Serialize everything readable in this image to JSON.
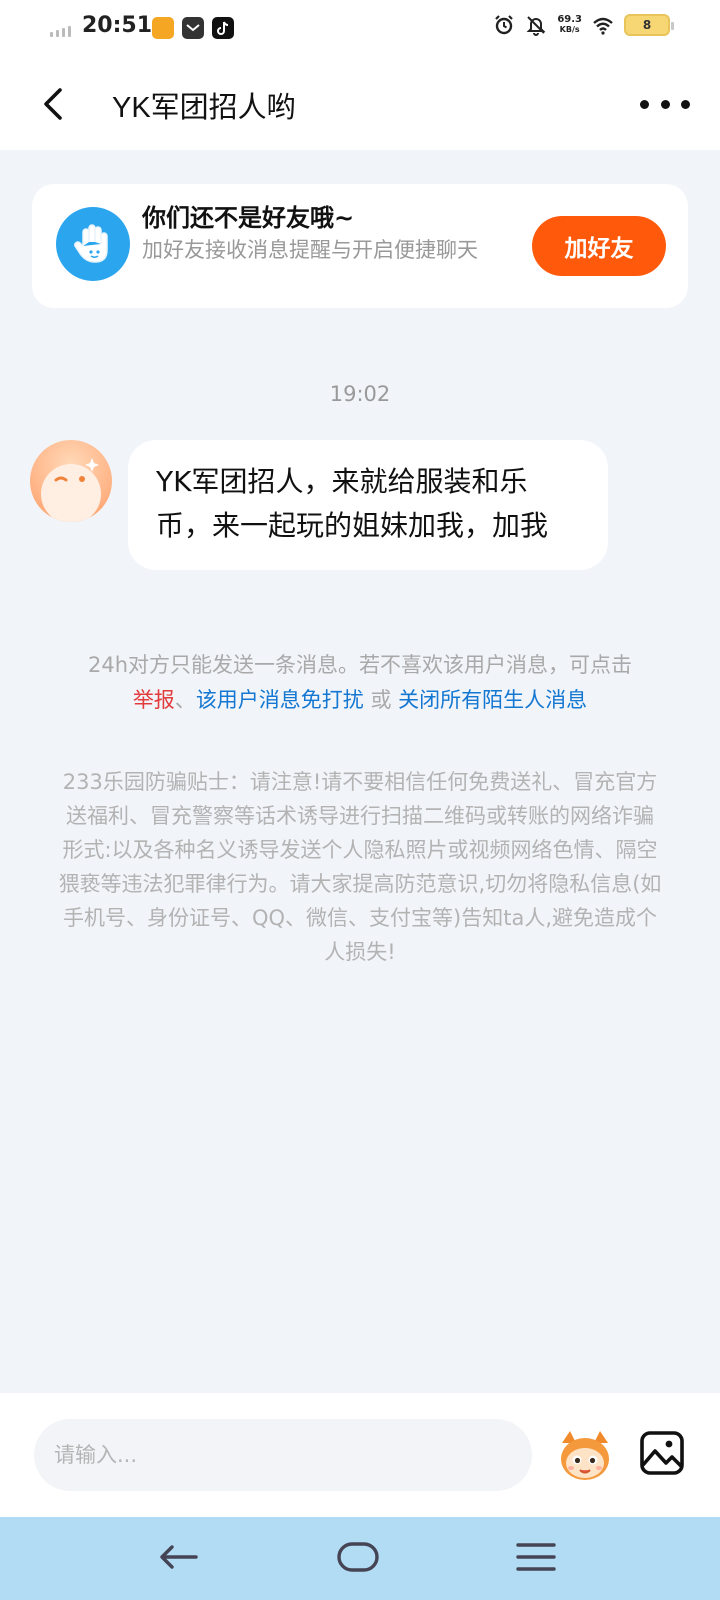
{
  "status_bar": {
    "time": "20:51",
    "net_speed_value": "69.3",
    "net_speed_unit": "KB/s",
    "battery_level": "8",
    "app_icons": [
      "video-app-icon",
      "mail-app-icon",
      "tiktok-icon"
    ],
    "status_icons": [
      "alarm-icon",
      "mute-icon",
      "wifi-icon",
      "battery-icon"
    ]
  },
  "header": {
    "title": "YK军团招人哟",
    "icons": [
      "back-arrow-icon",
      "more-dots-icon"
    ]
  },
  "friend_card": {
    "title": "你们还不是好友哦~",
    "subtitle": "加好友接收消息提醒与开启便捷聊天",
    "button_label": "加好友",
    "icon": "wave-hand-icon"
  },
  "chat": {
    "timestamp": "19:02",
    "message": "YK军团招人，来就给服装和乐币，来一起玩的姐妹加我，加我"
  },
  "notice": {
    "text": "24h对方只能发送一条消息。若不喜欢该用户消息，可点击",
    "report_link": "举报",
    "sep1": "、",
    "dnd_link": "该用户消息免打扰",
    "or_text": " 或 ",
    "close_all_link": "关闭所有陌生人消息"
  },
  "tips": {
    "text": "233乐园防骗贴士：请注意!请不要相信任何免费送礼、冒充官方送福利、冒充警察等话术诱导进行扫描二维码或转账的网络诈骗形式:以及各种名义诱导发送个人隐私照片或视频网络色情、隔空猥亵等违法犯罪律行为。请大家提高防范意识,切勿将隐私信息(如手机号、身份证号、QQ、微信、支付宝等)告知ta人,避免造成个人损失!"
  },
  "input_bar": {
    "placeholder": "请输入...",
    "icons": [
      "emoji-mascot-icon",
      "image-icon"
    ]
  },
  "nav_bar": {
    "icons": [
      "nav-back-icon",
      "nav-home-icon",
      "nav-menu-icon"
    ]
  },
  "colors": {
    "accent": "#FF5A0C",
    "link_blue": "#1477D2",
    "report_red": "#E23B3B",
    "background": "#F1F4F9",
    "nav_bar": "#B2DCF4"
  }
}
